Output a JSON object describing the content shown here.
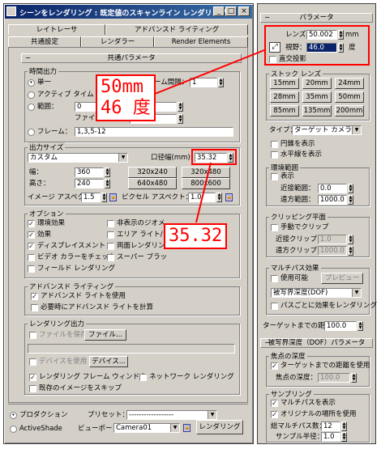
{
  "dialog": {
    "title": "シーンをレンダリング : 既定値のスキャンライン レンダリング",
    "window_buttons": [
      "_",
      "□",
      "×"
    ],
    "tabs_row1": [
      "レイトレーサ",
      "アドバンスド ライティング"
    ],
    "tabs_row2": [
      "共通設定",
      "レンダラー",
      "Render Elements"
    ],
    "rollout_title": "共通パラメータ",
    "time_output": {
      "title": "時間出力",
      "single": "単一",
      "active_time": "アクティブ タイム セグ",
      "every_nth_label": "ーム間隔：",
      "every_nth_value": "1",
      "range": "範囲：",
      "range_start": "0",
      "file_label": "ファイル",
      "frames": "フレーム：",
      "frames_value": "1,3,5-12"
    },
    "output_size": {
      "title": "出力サイズ",
      "preset": "カスタム",
      "aperture_label": "口径幅(mm):",
      "aperture_value": "35.32",
      "width_label": "幅：",
      "width_value": "360",
      "height_label": "高さ：",
      "height_value": "240",
      "presets": [
        "320x240",
        "320x480",
        "640x480",
        "800x600"
      ],
      "image_aspect_label": "イメージ アスペクト：",
      "image_aspect_value": "1.5",
      "pixel_aspect_label": "ピクセル アスペクト：",
      "pixel_aspect_value": "1.0"
    },
    "options": {
      "title": "オプション",
      "items_left": [
        "環境効果",
        "効果",
        "ディスプレイスメント",
        "ビデオ カラーをチェック",
        "フィールド レンダリング"
      ],
      "items_right": [
        "非表示のジオメ",
        "エリア ライト/シ",
        "両面レンダリング",
        "スーパー ブラッ"
      ]
    },
    "advanced_lighting": {
      "title": "アドバンスド ライティング",
      "use": "アドバンスド ライトを使用",
      "compute": "必要時にアドバンスド ライトを計算"
    },
    "render_output": {
      "title": "レンダリング出力",
      "save_file": "ファイルを保存",
      "files_button": "ファイル...",
      "use_device": "デバイスを使用",
      "devices_button": "デバイス...",
      "frame_window": "レンダリング フレーム ウィンドウ",
      "net_render": "ネットワーク レンダリング",
      "skip_existing": "既存のイメージをスキップ"
    },
    "bottom": {
      "production": "プロダクション",
      "activeshade": "ActiveShade",
      "preset_label": "プリセット：",
      "preset_value": "------------------",
      "viewport_label": "ビューポート：",
      "viewport_value": "Camera01",
      "render_button": "レンダリング"
    }
  },
  "panel": {
    "params_title": "パラメータ",
    "lens_label": "レンズ：",
    "lens_value": "50.002",
    "lens_unit": "mm",
    "fov_label": "視野：",
    "fov_value": "46.0",
    "fov_unit": "度",
    "ortho": "直交投影",
    "stock_lens_title": "ストック レンズ",
    "stock_lenses": [
      "15mm",
      "20mm",
      "24mm",
      "28mm",
      "35mm",
      "50mm",
      "85mm",
      "135mm",
      "200mm"
    ],
    "type_label": "タイプ：",
    "type_value": "ターゲット カメラ",
    "show_cone": "円錐を表示",
    "show_horizon": "水平線を表示",
    "env_title": "環境範囲",
    "env_show": "表示",
    "near_range_label": "近接範囲：",
    "near_range_value": "0.0",
    "far_range_label": "遠方範囲：",
    "far_range_value": "1000.0",
    "clip_title": "クリッピング平面",
    "clip_manual": "手動でクリップ",
    "near_clip_label": "近接クリップ：",
    "near_clip_value": "1.0",
    "far_clip_label": "遠方クリップ：",
    "far_clip_value": "1000.0",
    "multipass_title": "マルチパス効果",
    "multipass_enable": "使用可能",
    "preview_button": "プレビュー",
    "multipass_type": "被写界深度(DOF)",
    "render_per_pass": "パスごとに効果をレンダリング",
    "target_dist_label": "ターゲットまでの距離：",
    "target_dist_value": "100.0",
    "dof_params_title": "被写界深度（DOF）パラメータ",
    "focal_title": "焦点の深度",
    "use_target_dist": "ターゲットまでの距離を使用",
    "focal_depth_label": "焦点の深度：",
    "focal_depth_value": "100.0",
    "sampling_title": "サンプリング",
    "display_passes": "マルチパスを表示",
    "use_original": "オリジナルの場所を使用",
    "total_passes_label": "総マルチパス数：",
    "total_passes_value": "12",
    "sample_radius_label": "サンプル半径：",
    "sample_radius_value": "1.0"
  },
  "annotations": {
    "callout_lens": "50mm",
    "callout_fov": "46 度",
    "callout_aperture": "35.32",
    "line_color": "#ff0000"
  }
}
